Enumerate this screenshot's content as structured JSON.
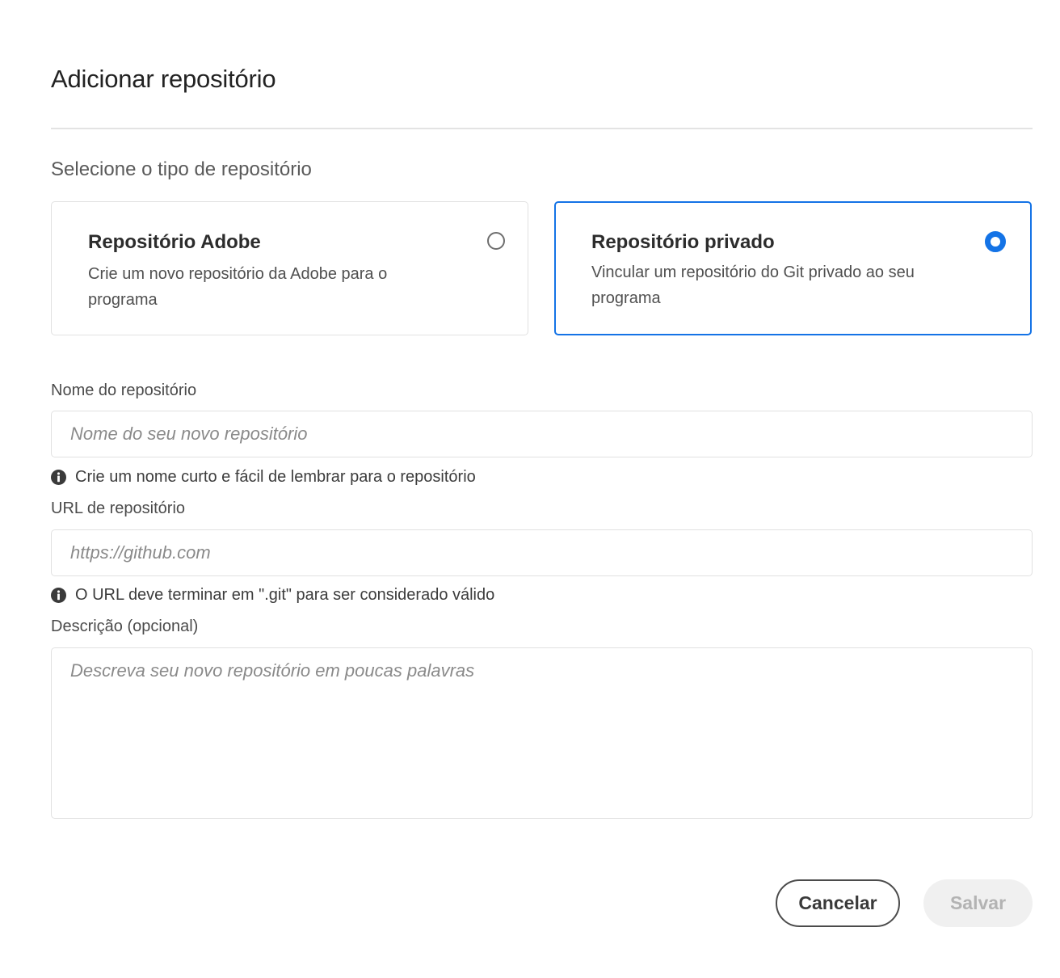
{
  "dialog": {
    "title": "Adicionar repositório"
  },
  "repo_type": {
    "label": "Selecione o tipo de repositório",
    "options": [
      {
        "title": "Repositório Adobe",
        "description": "Crie um novo repositório da Adobe para o programa",
        "selected": false
      },
      {
        "title": "Repositório privado",
        "description": "Vincular um repositório do Git privado ao seu programa",
        "selected": true
      }
    ]
  },
  "fields": {
    "name": {
      "label": "Nome do repositório",
      "placeholder": "Nome do seu novo repositório",
      "value": "",
      "help": "Crie um nome curto e fácil de lembrar para o repositório"
    },
    "url": {
      "label": "URL de repositório",
      "placeholder": "https://github.com",
      "value": "",
      "help": "O URL deve terminar em \".git\" para ser considerado válido"
    },
    "description": {
      "label": "Descrição (opcional)",
      "placeholder": "Descreva seu novo repositório em poucas palavras",
      "value": ""
    }
  },
  "actions": {
    "cancel_label": "Cancelar",
    "save_label": "Salvar",
    "save_enabled": false
  },
  "colors": {
    "accent": "#1473e6",
    "disabled_bg": "#f0f0f0",
    "disabled_text": "#b3b3b3"
  },
  "icons": {
    "radio_unchecked": "radio-unchecked-icon",
    "radio_checked": "radio-checked-icon",
    "info": "info-icon"
  }
}
